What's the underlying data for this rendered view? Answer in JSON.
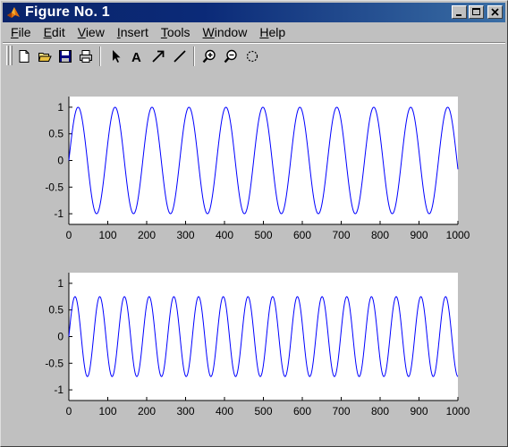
{
  "window": {
    "title": "Figure No. 1"
  },
  "menu": [
    {
      "label": "File",
      "accel": "F",
      "rest": "ile"
    },
    {
      "label": "Edit",
      "accel": "E",
      "rest": "dit"
    },
    {
      "label": "View",
      "accel": "V",
      "rest": "iew"
    },
    {
      "label": "Insert",
      "accel": "I",
      "rest": "nsert"
    },
    {
      "label": "Tools",
      "accel": "T",
      "rest": "ools"
    },
    {
      "label": "Window",
      "accel": "W",
      "rest": "indow"
    },
    {
      "label": "Help",
      "accel": "H",
      "rest": "elp"
    }
  ],
  "toolbar": {
    "tools": [
      "new-file-icon",
      "open-folder-icon",
      "save-disk-icon",
      "print-icon",
      "select-arrow-icon",
      "insert-text-icon",
      "insert-arrow-icon",
      "insert-line-icon",
      "zoom-in-icon",
      "zoom-out-icon",
      "rotate-3d-icon"
    ]
  },
  "colors": {
    "title_bar": "#0a246a",
    "face": "#c0c0c0",
    "plot_line": "#0000ff"
  },
  "chart_data": [
    {
      "type": "line",
      "function": "sin",
      "amplitude": 1,
      "period": 95,
      "x_range": [
        0,
        1000
      ],
      "xlim": [
        0,
        1000
      ],
      "ylim": [
        -1.2,
        1.2
      ],
      "xticks": [
        0,
        100,
        200,
        300,
        400,
        500,
        600,
        700,
        800,
        900,
        1000
      ],
      "yticks": [
        1,
        0.5,
        0,
        -0.5,
        -1
      ],
      "xtick_labels": [
        "0",
        "100",
        "200",
        "300",
        "400",
        "500",
        "600",
        "700",
        "800",
        "900",
        "1000"
      ],
      "ytick_labels": [
        "1",
        "0.5",
        "0",
        "-0.5",
        "-1"
      ],
      "title": "",
      "xlabel": "",
      "ylabel": ""
    },
    {
      "type": "line",
      "function": "sin",
      "amplitude": 0.75,
      "period": 63.5,
      "x_range": [
        0,
        1000
      ],
      "xlim": [
        0,
        1000
      ],
      "ylim": [
        -1.2,
        1.2
      ],
      "xticks": [
        0,
        100,
        200,
        300,
        400,
        500,
        600,
        700,
        800,
        900,
        1000
      ],
      "yticks": [
        1,
        0.5,
        0,
        -0.5,
        -1
      ],
      "xtick_labels": [
        "0",
        "100",
        "200",
        "300",
        "400",
        "500",
        "600",
        "700",
        "800",
        "900",
        "1000"
      ],
      "ytick_labels": [
        "1",
        "0.5",
        "0",
        "-0.5",
        "-1"
      ],
      "title": "",
      "xlabel": "",
      "ylabel": ""
    }
  ]
}
